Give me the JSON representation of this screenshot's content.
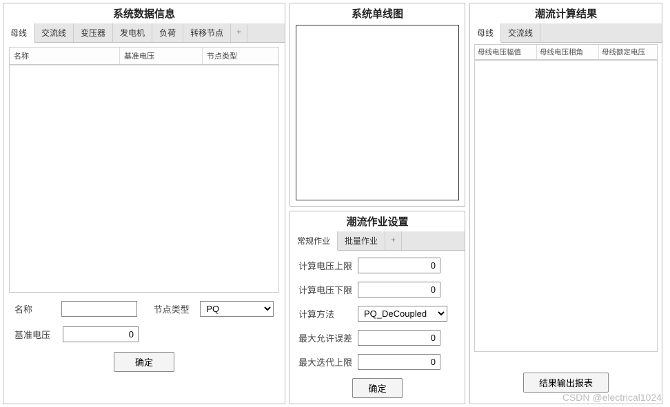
{
  "left": {
    "title": "系统数据信息",
    "tabs": [
      "母线",
      "交流线",
      "变压器",
      "发电机",
      "负荷",
      "转移节点"
    ],
    "plus": "+",
    "columns": [
      "名称",
      "基准电压",
      "节点类型"
    ],
    "form": {
      "name_label": "名称",
      "name_value": "",
      "node_type_label": "节点类型",
      "node_type_value": "PQ",
      "base_voltage_label": "基准电压",
      "base_voltage_value": "0",
      "confirm_label": "确定"
    }
  },
  "mid_top": {
    "title": "系统单线图"
  },
  "mid_bottom": {
    "title": "潮流作业设置",
    "tabs": [
      "常规作业",
      "批量作业"
    ],
    "plus": "+",
    "form": {
      "v_upper_label": "计算电压上限",
      "v_upper_value": "0",
      "v_lower_label": "计算电压下限",
      "v_lower_value": "0",
      "method_label": "计算方法",
      "method_value": "PQ_DeCoupled",
      "tol_label": "最大允许误差",
      "tol_value": "0",
      "max_iter_label": "最大迭代上限",
      "max_iter_value": "0",
      "confirm_label": "确定"
    }
  },
  "right": {
    "title": "潮流计算结果",
    "tabs": [
      "母线",
      "交流线"
    ],
    "columns": [
      "母线电压幅值",
      "母线电压相角",
      "母线额定电压"
    ],
    "export_label": "结果输出报表"
  },
  "watermark": "CSDN @electrical1024"
}
